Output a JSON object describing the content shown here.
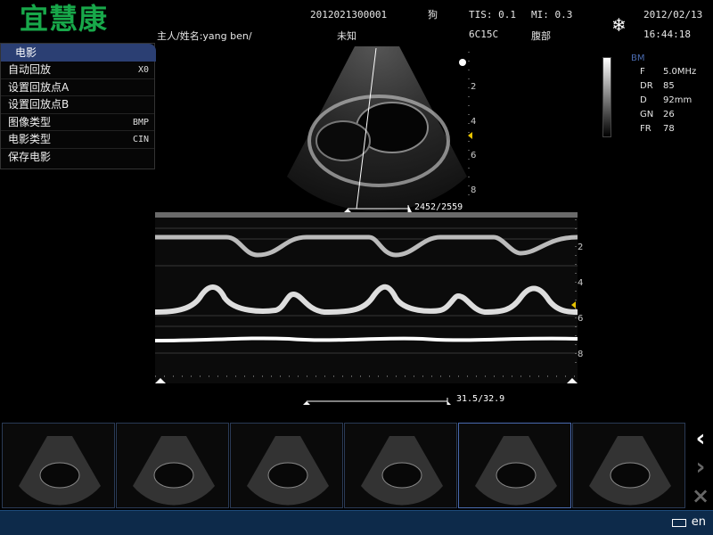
{
  "header": {
    "brand": "宜慧康",
    "owner_label": "主人/姓名:yang ben/",
    "patient_id": "2012021300001",
    "species": "狗",
    "tis": "TIS: 0.1",
    "mi": "MI: 0.3",
    "date": "2012/02/13",
    "gender": "未知",
    "probe": "6C15C",
    "exam": "腹部",
    "time": "16:44:18",
    "freeze_icon": "snowflake-icon"
  },
  "menu": {
    "title": "电影",
    "items": [
      {
        "label": "自动回放",
        "value": "X0"
      },
      {
        "label": "设置回放点A",
        "value": ""
      },
      {
        "label": "设置回放点B",
        "value": ""
      },
      {
        "label": "图像类型",
        "value": "BMP"
      },
      {
        "label": "电影类型",
        "value": "CIN"
      },
      {
        "label": "保存电影",
        "value": ""
      }
    ]
  },
  "params": {
    "mode": "BM",
    "rows": [
      {
        "k": "F",
        "v": "5.0MHz"
      },
      {
        "k": "DR",
        "v": "85"
      },
      {
        "k": "D",
        "v": "92mm"
      },
      {
        "k": "GN",
        "v": "26"
      },
      {
        "k": "FR",
        "v": "78"
      }
    ]
  },
  "bmode": {
    "depth_ticks": [
      "2",
      "4",
      "6",
      "8"
    ],
    "frame_counter": "2452/2559"
  },
  "mmode": {
    "depth_ticks": [
      "2",
      "4",
      "6",
      "8"
    ],
    "time_counter": "31.5/32.9"
  },
  "thumbnails": {
    "count": 6
  },
  "nav": {
    "prev": "‹",
    "next": "›",
    "close": "×"
  },
  "status": {
    "language": "en"
  }
}
